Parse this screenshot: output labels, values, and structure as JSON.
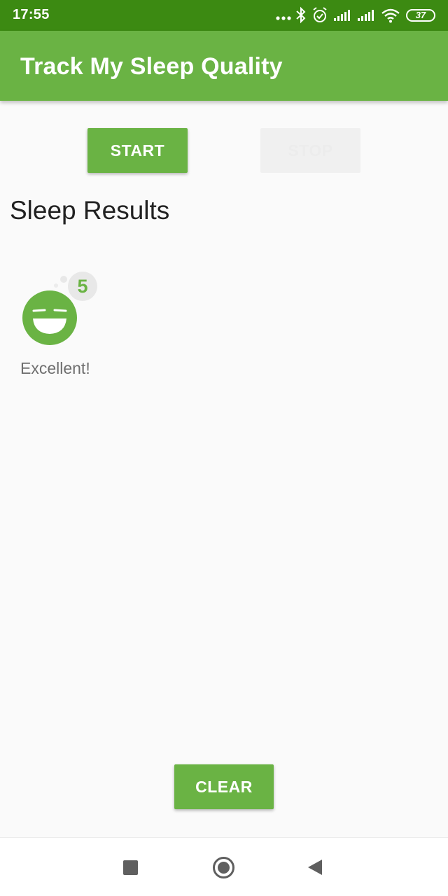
{
  "status_bar": {
    "time": "17:55",
    "dots": "...",
    "battery": "37",
    "icons": [
      "more-dots-icon",
      "bluetooth-icon",
      "alarm-icon",
      "signal-icon",
      "signal-icon",
      "wifi-icon",
      "battery-icon"
    ]
  },
  "app_bar": {
    "title": "Track My Sleep Quality",
    "color": "#6ab344"
  },
  "controls": {
    "start_label": "START",
    "stop_label": "STOP",
    "clear_label": "CLEAR"
  },
  "results": {
    "heading": "Sleep Results",
    "items": [
      {
        "quality": "5",
        "label": "Excellent!",
        "icon": "excellent-face-icon"
      }
    ]
  },
  "nav_bar": {
    "icons": [
      "recents-icon",
      "home-icon",
      "back-icon"
    ]
  },
  "colors": {
    "status_bar": "#3c8a12",
    "accent": "#6ab344",
    "background": "#fafafa",
    "disabled_button": "#f0f0f0"
  }
}
